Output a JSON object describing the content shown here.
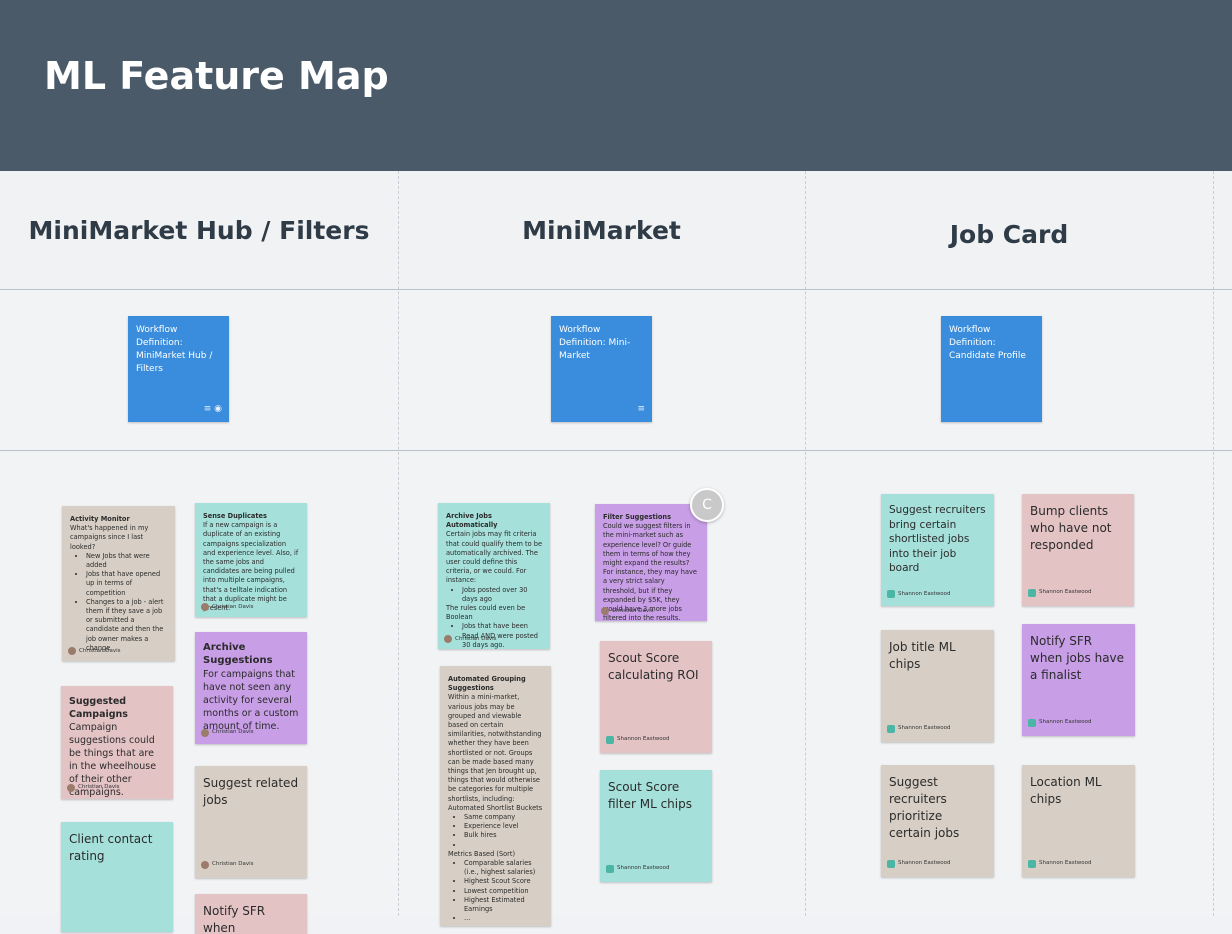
{
  "header": {
    "title": "ML Feature Map"
  },
  "columns": [
    {
      "title": "MiniMarket Hub / Filters"
    },
    {
      "title": "MiniMarket"
    },
    {
      "title": "Job Card"
    }
  ],
  "workflows": [
    {
      "text": "Workflow Definition: MiniMarket Hub / Filters",
      "icons": "≡ ◉"
    },
    {
      "text": "Workflow Definition: Mini-Market",
      "icons": "≡"
    },
    {
      "text": "Workflow Definition: Candidate Profile",
      "icons": ""
    }
  ],
  "notes": {
    "activity_monitor": {
      "title": "Activity Monitor",
      "intro": "What's happened in my campaigns since I last looked?",
      "bullets": [
        "New Jobs that were added",
        "Jobs that have opened up in terms of competition",
        "Changes to a job - alert them if they save a job or submitted a candidate and then the job owner makes a change"
      ],
      "author": "Christian Davis"
    },
    "sense_duplicates": {
      "title": "Sense Duplicates",
      "body": "If a new campaign is a duplicate of an existing campaigns specialization and experience level. Also, if the same jobs and candidates are being pulled into multiple campaigns, that's a telltale indication that a duplicate might be present.",
      "author": "Christian Davis"
    },
    "archive_suggestions": {
      "title": "Archive Suggestions",
      "body": "For campaigns that have not seen any activity for several months or a custom amount of time.",
      "author": "Christian Davis"
    },
    "suggested_campaigns": {
      "title": "Suggested Campaigns",
      "body": "Campaign suggestions could be things that are in the wheelhouse of their other campaigns.",
      "author": "Christian Davis"
    },
    "suggest_related_jobs": {
      "body": "Suggest related jobs",
      "author": "Christian Davis"
    },
    "client_contact_rating": {
      "body": "Client contact rating"
    },
    "notify_sfr_partial": {
      "body": "Notify SFR when"
    },
    "archive_jobs": {
      "title": "Archive Jobs Automatically",
      "body": "Certain jobs may fit criteria that could qualify them to be automatically archived. The user could define this criteria, or we could. For instance:",
      "bullets1": [
        "Jobs posted over 30 days ago"
      ],
      "mid": "The rules could even be Boolean",
      "bullets2": [
        "Jobs that have been Read AND were posted 30 days ago."
      ],
      "author": "Christian Davis"
    },
    "filter_suggestions": {
      "title": "Filter Suggestions",
      "body": "Could we suggest filters in the mini-market such as experience level? Or guide them in terms of how they might expand the results? For instance, they may have a very strict salary threshold, but if they expanded by $5K, they would have 3 more jobs filtered into the results.",
      "author": "Christian Davis"
    },
    "automated_grouping": {
      "title": "Automated Grouping Suggestions",
      "body": "Within a mini-market, various jobs may be grouped and viewable based on certain similarities, notwithstanding whether they have been shortlisted or not. Groups can be made based many things that Jen brought up, things that would otherwise be categories for multiple shortlists, including:",
      "sub1": "Automated Shortlist Buckets",
      "bullets1": [
        "Same company",
        "Experience level",
        "Bulk hires",
        ""
      ],
      "sub2": "Metrics Based (Sort)",
      "bullets2": [
        "Comparable salaries (i.e., highest salaries)",
        "Highest Scout Score",
        "Lowest competition",
        "Highest Estimated Earnings",
        "..."
      ]
    },
    "scout_score_roi": {
      "body": "Scout Score calculating ROI",
      "author": "Shannon Eastwood"
    },
    "scout_score_filter": {
      "body": "Scout Score filter ML chips",
      "author": "Shannon Eastwood"
    },
    "suggest_recruiters_shortlisted": {
      "body": "Suggest recruiters bring certain shortlisted jobs into their job board",
      "author": "Shannon Eastwood"
    },
    "bump_clients": {
      "body": "Bump clients who have not responded",
      "author": "Shannon Eastwood"
    },
    "job_title_ml": {
      "body": "Job title ML chips",
      "author": "Shannon Eastwood"
    },
    "notify_sfr_finalist": {
      "body": "Notify SFR when jobs have a finalist",
      "author": "Shannon Eastwood"
    },
    "suggest_prioritize": {
      "body": "Suggest recruiters prioritize certain jobs",
      "author": "Shannon Eastwood"
    },
    "location_ml": {
      "body": "Location ML chips",
      "author": "Shannon Eastwood"
    }
  },
  "collaborator_badge": {
    "initial": "C"
  },
  "colors": {
    "header": "#4a5a69",
    "workflow": "#3a8ddc",
    "tan": "#d7cfc5",
    "teal": "#a6e0db",
    "pink": "#e4c3c5",
    "purple": "#c89ee6"
  }
}
